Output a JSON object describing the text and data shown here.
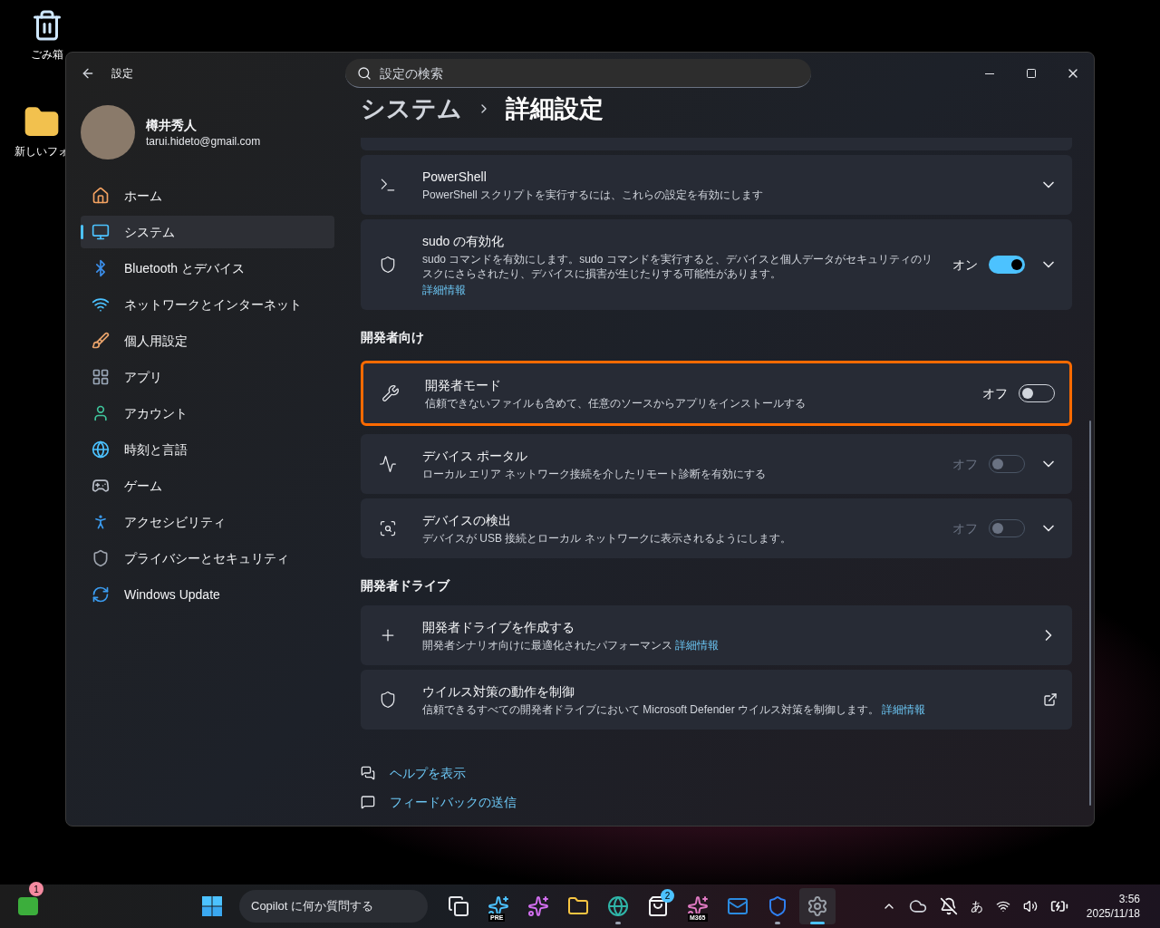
{
  "desktop_icons": [
    {
      "label": "ごみ箱",
      "kind": "recycle-bin"
    },
    {
      "label": "新しいフォ",
      "kind": "folder"
    }
  ],
  "window": {
    "title": "設定",
    "search": {
      "placeholder": "設定の検索"
    },
    "account": {
      "name": "樽井秀人",
      "email": "tarui.hideto@gmail.com"
    },
    "nav": [
      {
        "label": "ホーム",
        "selected": false
      },
      {
        "label": "システム",
        "selected": true
      },
      {
        "label": "Bluetooth とデバイス",
        "selected": false
      },
      {
        "label": "ネットワークとインターネット",
        "selected": false
      },
      {
        "label": "個人用設定",
        "selected": false
      },
      {
        "label": "アプリ",
        "selected": false
      },
      {
        "label": "アカウント",
        "selected": false
      },
      {
        "label": "時刻と言語",
        "selected": false
      },
      {
        "label": "ゲーム",
        "selected": false
      },
      {
        "label": "アクセシビリティ",
        "selected": false
      },
      {
        "label": "プライバシーとセキュリティ",
        "selected": false
      },
      {
        "label": "Windows Update",
        "selected": false
      }
    ],
    "breadcrumb": [
      "システム",
      "詳細設定"
    ],
    "sections": [
      {
        "items": [
          {
            "kind": "expander",
            "title": "PowerShell",
            "description": "PowerShell スクリプトを実行するには、これらの設定を有効にします"
          },
          {
            "kind": "toggle-expander",
            "title": "sudo の有効化",
            "description": "sudo コマンドを有効にします。sudo コマンドを実行すると、デバイスと個人データがセキュリティのリスクにさらされたり、デバイスに損害が生じたりする可能性があります。",
            "link": "詳細情報",
            "on": true,
            "state_label": "オン",
            "disabled": false,
            "highlighted": false
          }
        ]
      },
      {
        "heading": "開発者向け",
        "items": [
          {
            "kind": "toggle",
            "title": "開発者モード",
            "description": "信頼できないファイルも含めて、任意のソースからアプリをインストールする",
            "on": false,
            "state_label": "オフ",
            "disabled": false,
            "highlighted": true
          },
          {
            "kind": "toggle-expander",
            "title": "デバイス ポータル",
            "description": "ローカル エリア ネットワーク接続を介したリモート診断を有効にする",
            "on": false,
            "state_label": "オフ",
            "disabled": true,
            "highlighted": false
          },
          {
            "kind": "toggle-expander",
            "title": "デバイスの検出",
            "description": "デバイスが USB 接続とローカル ネットワークに表示されるようにします。",
            "on": false,
            "state_label": "オフ",
            "disabled": true,
            "highlighted": false
          }
        ]
      },
      {
        "heading": "開発者ドライブ",
        "items": [
          {
            "kind": "navigate",
            "title": "開発者ドライブを作成する",
            "description": "開発者シナリオ向けに最適化されたパフォーマンス",
            "link": "詳細情報"
          },
          {
            "kind": "external",
            "title": "ウイルス対策の動作を制御",
            "description": "信頼できるすべての開発者ドライブにおいて Microsoft Defender ウイルス対策を制御します。",
            "link": "詳細情報"
          }
        ]
      }
    ],
    "help_links": [
      "ヘルプを表示",
      "フィードバックの送信"
    ]
  },
  "taskbar": {
    "widgets_badge": "1",
    "search_label": "Copilot に何か質問する",
    "apps": [
      {
        "running": false,
        "selected": false
      },
      {
        "badge": "PRE",
        "running": false,
        "selected": false
      },
      {
        "running": false,
        "selected": false
      },
      {
        "running": false,
        "selected": false
      },
      {
        "running": true,
        "selected": false
      },
      {
        "count": "2",
        "running": false,
        "selected": false
      },
      {
        "badge": "M365",
        "running": false,
        "selected": false
      },
      {
        "running": false,
        "selected": false
      },
      {
        "running": true,
        "selected": false
      },
      {
        "running": true,
        "selected": true
      }
    ],
    "tray": {
      "ime": "あ",
      "time": "3:56",
      "date": "2025/11/18"
    }
  }
}
